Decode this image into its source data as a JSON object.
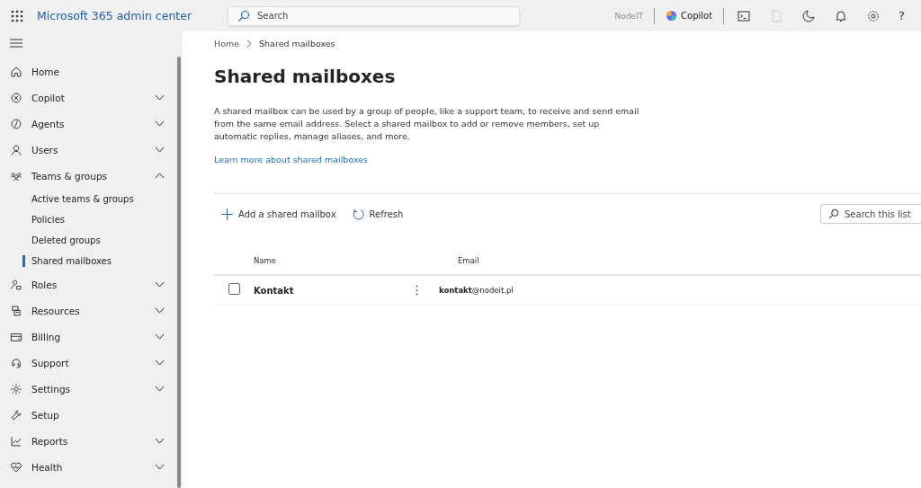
{
  "header": {
    "title": "Microsoft 365 admin center",
    "search": {
      "placeholder": "Search"
    },
    "tenant": "NodeIT",
    "copilot": "Copilot",
    "help": "?"
  },
  "sidebar": {
    "items": [
      {
        "label": "Home",
        "kind": "link",
        "selected": false
      },
      {
        "label": "Copilot",
        "kind": "group",
        "expanded": false,
        "selected": false
      },
      {
        "label": "Agents",
        "kind": "group",
        "expanded": false,
        "selected": false
      },
      {
        "label": "Users",
        "kind": "group",
        "expanded": false,
        "selected": false
      },
      {
        "label": "Teams & groups",
        "kind": "group",
        "expanded": true,
        "selected": false,
        "children": [
          {
            "label": "Active teams & groups",
            "selected": false
          },
          {
            "label": "Policies",
            "selected": false
          },
          {
            "label": "Deleted groups",
            "selected": false
          },
          {
            "label": "Shared mailboxes",
            "selected": true
          }
        ]
      },
      {
        "label": "Roles",
        "kind": "group",
        "expanded": false,
        "selected": false
      },
      {
        "label": "Resources",
        "kind": "group",
        "expanded": false,
        "selected": false
      },
      {
        "label": "Billing",
        "kind": "group",
        "expanded": false,
        "selected": false
      },
      {
        "label": "Support",
        "kind": "group",
        "expanded": false,
        "selected": false
      },
      {
        "label": "Settings",
        "kind": "group",
        "expanded": false,
        "selected": false
      },
      {
        "label": "Setup",
        "kind": "link",
        "selected": false
      },
      {
        "label": "Reports",
        "kind": "group",
        "expanded": false,
        "selected": false
      },
      {
        "label": "Health",
        "kind": "group",
        "expanded": false,
        "selected": false
      }
    ]
  },
  "breadcrumb": [
    "Home",
    "Shared mailboxes"
  ],
  "page": {
    "title": "Shared mailboxes",
    "description": "A shared mailbox can be used by a group of people, like a support team, to receive and send email from the same email address. Select a shared mailbox to add or remove members, set up automatic replies, manage aliases, and more.",
    "link": "Learn more about shared mailboxes"
  },
  "toolbar": {
    "add": "Add a shared mailbox",
    "refresh": "Refresh",
    "search": {
      "placeholder": "Search this list"
    }
  },
  "table": {
    "columns": [
      "Name",
      "Email"
    ],
    "rows": [
      {
        "name": "Kontakt",
        "email": "**kontakt**@nodeit.pl",
        "checked": false
      }
    ]
  }
}
